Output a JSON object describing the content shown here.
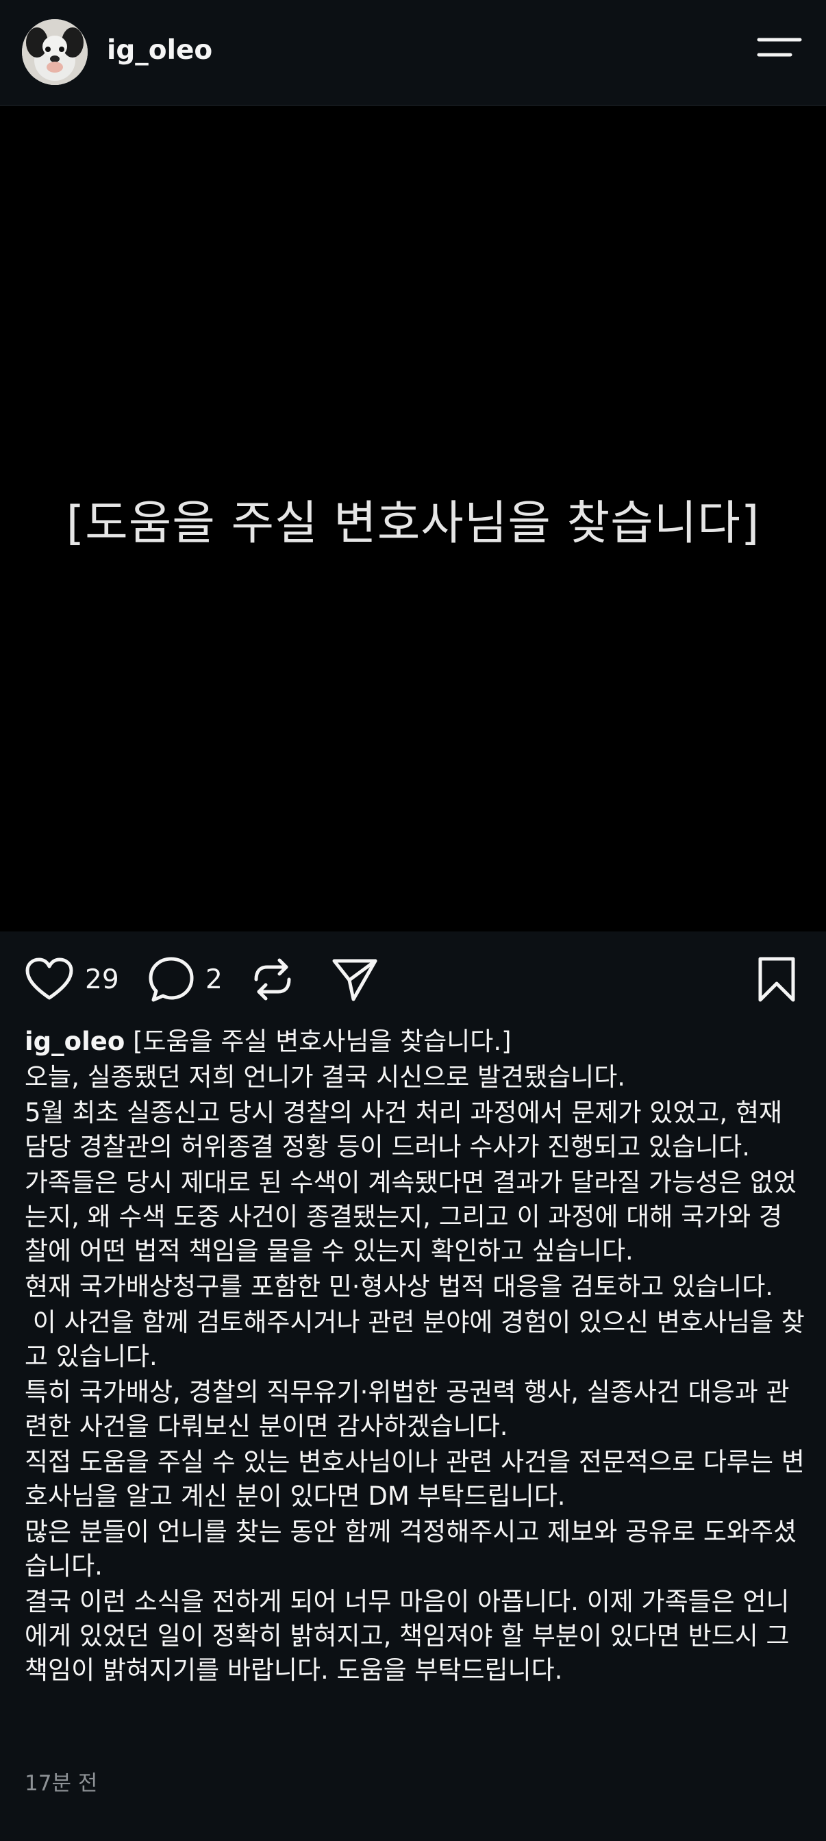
{
  "header": {
    "username": "ig_oleo",
    "avatar_icon": "dog-avatar",
    "menu_icon": "menu-icon"
  },
  "media": {
    "text": "[도움을 주실 변호사님을 찾습니다]"
  },
  "actions": {
    "likes": "29",
    "comments": "2",
    "like_icon": "heart-icon",
    "comment_icon": "comment-icon",
    "repost_icon": "repost-icon",
    "share_icon": "send-icon",
    "save_icon": "bookmark-icon"
  },
  "caption": {
    "username": "ig_oleo",
    "title": "[도움을 주실 변호사님을 찾습니다.]",
    "paragraphs": [
      "오늘, 실종됐던 저희 언니가 결국 시신으로 발견됐습니다.",
      "5월 최초 실종신고 당시 경찰의 사건 처리 과정에서 문제가 있었고, 현재 담당 경찰관의 허위종결 정황 등이 드러나 수사가 진행되고 있습니다.",
      "가족들은 당시 제대로 된 수색이 계속됐다면 결과가 달라질 가능성은 없었는지, 왜 수색 도중 사건이 종결됐는지, 그리고 이 과정에 대해 국가와 경찰에 어떤 법적 책임을 물을 수 있는지 확인하고 싶습니다.",
      "현재 국가배상청구를 포함한 민·형사상 법적 대응을 검토하고 있습니다.",
      " 이 사건을 함께 검토해주시거나 관련 분야에 경험이 있으신 변호사님을 찾고 있습니다.",
      "특히 국가배상, 경찰의 직무유기·위법한 공권력 행사, 실종사건 대응과 관련한 사건을 다뤄보신 분이면 감사하겠습니다.",
      "직접 도움을 주실 수 있는 변호사님이나 관련 사건을 전문적으로 다루는 변호사님을 알고 계신 분이 있다면 DM 부탁드립니다.",
      "많은 분들이 언니를 찾는 동안 함께 걱정해주시고 제보와 공유로 도와주셨습니다.",
      "결국 이런 소식을 전하게 되어 너무 마음이 아픕니다. 이제 가족들은 언니에게 있었던 일이 정확히 밝혀지고, 책임져야 할 부분이 있다면 반드시 그 책임이 밝혀지기를 바랍니다. 도움을 부탁드립니다."
    ]
  },
  "timestamp": "17분 전"
}
